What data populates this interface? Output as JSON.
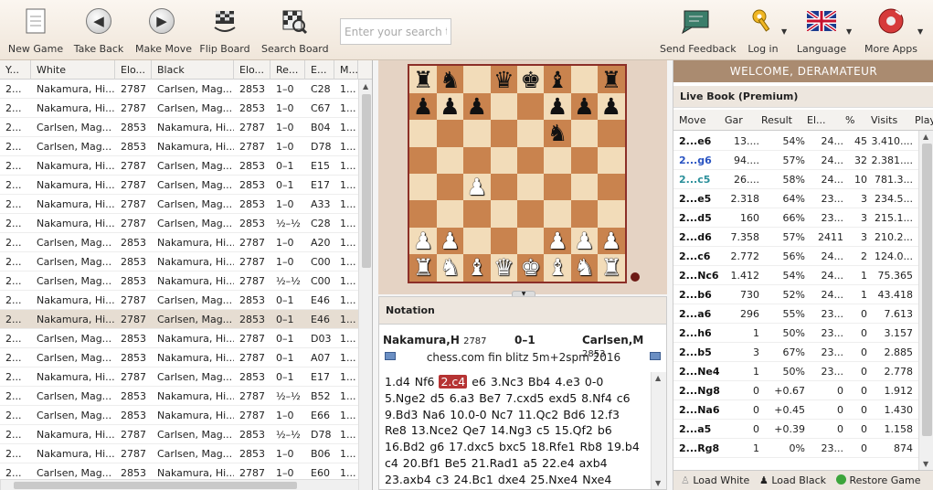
{
  "toolbar": {
    "new_game": "New Game",
    "take_back": "Take Back",
    "make_move": "Make Move",
    "flip_board": "Flip Board",
    "search_board": "Search Board",
    "search_placeholder": "Enter your search tex",
    "feedback": "Send Feedback",
    "login": "Log in",
    "language": "Language",
    "more_apps": "More Apps"
  },
  "games": {
    "headers": [
      "Y...",
      "White",
      "Elo...",
      "Black",
      "Elo...",
      "Re...",
      "E...",
      "M..."
    ],
    "rows": [
      [
        "2...",
        "Nakamura, Hi...",
        "2787",
        "Carlsen, Mag...",
        "2853",
        "1–0",
        "C28",
        "1..."
      ],
      [
        "2...",
        "Nakamura, Hi...",
        "2787",
        "Carlsen, Mag...",
        "2853",
        "1–0",
        "C67",
        "1..."
      ],
      [
        "2...",
        "Carlsen, Mag...",
        "2853",
        "Nakamura, Hi...",
        "2787",
        "1–0",
        "B04",
        "1..."
      ],
      [
        "2...",
        "Carlsen, Mag...",
        "2853",
        "Nakamura, Hi...",
        "2787",
        "1–0",
        "D78",
        "1..."
      ],
      [
        "2...",
        "Nakamura, Hi...",
        "2787",
        "Carlsen, Mag...",
        "2853",
        "0–1",
        "E15",
        "1..."
      ],
      [
        "2...",
        "Nakamura, Hi...",
        "2787",
        "Carlsen, Mag...",
        "2853",
        "0–1",
        "E17",
        "1..."
      ],
      [
        "2...",
        "Nakamura, Hi...",
        "2787",
        "Carlsen, Mag...",
        "2853",
        "1–0",
        "A33",
        "1..."
      ],
      [
        "2...",
        "Nakamura, Hi...",
        "2787",
        "Carlsen, Mag...",
        "2853",
        "½–½",
        "C28",
        "1..."
      ],
      [
        "2...",
        "Carlsen, Mag...",
        "2853",
        "Nakamura, Hi...",
        "2787",
        "1–0",
        "A20",
        "1..."
      ],
      [
        "2...",
        "Carlsen, Mag...",
        "2853",
        "Nakamura, Hi...",
        "2787",
        "1–0",
        "C00",
        "1..."
      ],
      [
        "2...",
        "Carlsen, Mag...",
        "2853",
        "Nakamura, Hi...",
        "2787",
        "½–½",
        "C00",
        "1..."
      ],
      [
        "2...",
        "Nakamura, Hi...",
        "2787",
        "Carlsen, Mag...",
        "2853",
        "0–1",
        "E46",
        "1..."
      ],
      [
        "2...",
        "Nakamura, Hi...",
        "2787",
        "Carlsen, Mag...",
        "2853",
        "0–1",
        "E46",
        "1..."
      ],
      [
        "2...",
        "Carlsen, Mag...",
        "2853",
        "Nakamura, Hi...",
        "2787",
        "0–1",
        "D03",
        "1..."
      ],
      [
        "2...",
        "Carlsen, Mag...",
        "2853",
        "Nakamura, Hi...",
        "2787",
        "0–1",
        "A07",
        "1..."
      ],
      [
        "2...",
        "Nakamura, Hi...",
        "2787",
        "Carlsen, Mag...",
        "2853",
        "0–1",
        "E17",
        "1..."
      ],
      [
        "2...",
        "Carlsen, Mag...",
        "2853",
        "Nakamura, Hi...",
        "2787",
        "½–½",
        "B52",
        "1..."
      ],
      [
        "2...",
        "Carlsen, Mag...",
        "2853",
        "Nakamura, Hi...",
        "2787",
        "1–0",
        "E66",
        "1..."
      ],
      [
        "2...",
        "Nakamura, Hi...",
        "2787",
        "Carlsen, Mag...",
        "2853",
        "½–½",
        "D78",
        "1..."
      ],
      [
        "2...",
        "Nakamura, Hi...",
        "2787",
        "Carlsen, Mag...",
        "2853",
        "1–0",
        "B06",
        "1..."
      ],
      [
        "2...",
        "Carlsen, Mag...",
        "2853",
        "Nakamura, Hi...",
        "2787",
        "1–0",
        "E60",
        "1..."
      ]
    ],
    "selected_row": 12
  },
  "board": {
    "rows": [
      "rn.qkb.r",
      "ppp..ppp",
      ".....n..",
      "........",
      "..P.....",
      "........",
      "PP...PPP",
      "RNBQKBNR"
    ]
  },
  "notation": {
    "title": "Notation",
    "white": "Nakamura,H",
    "white_elo": "2787",
    "result": "0–1",
    "black": "Carlsen,M",
    "black_elo": "2853",
    "event": "chess.com fin blitz 5m+2spm 2016",
    "moves_before": "1.d4  Nf6 ",
    "current_move": "2.c4",
    "moves_after": " e6  3.Nc3  Bb4  4.e3  0-0  5.Nge2  d5  6.a3  Be7  7.cxd5  exd5  8.Nf4  c6  9.Bd3  Na6  10.0-0  Nc7  11.Qc2  Bd6  12.f3  Re8  13.Nce2  Qe7  14.Ng3  c5  15.Qf2  b6  16.Bd2  g6  17.dxc5  bxc5  18.Rfe1  Rb8  19.b4  c4  20.Bf1  Be5  21.Rad1  a5  22.e4  axb4  23.axb4  c3  24.Bc1  dxe4  25.Nxe4  Nxe4"
  },
  "right": {
    "welcome": "WELCOME, DERAMATEUR",
    "livebook": "Live Book (Premium)",
    "headers": [
      "Move",
      "Gar",
      "Result",
      "El...",
      "%",
      "Visits",
      "Play"
    ],
    "rows": [
      [
        "2...e6",
        "13....",
        "54%",
        "24...",
        "45",
        "3.410....",
        "#111"
      ],
      [
        "2...g6",
        "94....",
        "57%",
        "24...",
        "32",
        "2.381....",
        "#2a54c2"
      ],
      [
        "2...c5",
        "26....",
        "58%",
        "24...",
        "10",
        "781.3...",
        "#2a8f9a"
      ],
      [
        "2...e5",
        "2.318",
        "64%",
        "23...",
        "3",
        "234.5...",
        "#111"
      ],
      [
        "2...d5",
        "160",
        "66%",
        "23...",
        "3",
        "215.1...",
        "#111"
      ],
      [
        "2...d6",
        "7.358",
        "57%",
        "2411",
        "3",
        "210.2...",
        "#111"
      ],
      [
        "2...c6",
        "2.772",
        "56%",
        "24...",
        "2",
        "124.0...",
        "#111"
      ],
      [
        "2...Nc6",
        "1.412",
        "54%",
        "24...",
        "1",
        "75.365",
        "#111"
      ],
      [
        "2...b6",
        "730",
        "52%",
        "24...",
        "1",
        "43.418",
        "#111"
      ],
      [
        "2...a6",
        "296",
        "55%",
        "23...",
        "0",
        "7.613",
        "#111"
      ],
      [
        "2...h6",
        "1",
        "50%",
        "23...",
        "0",
        "3.157",
        "#111"
      ],
      [
        "2...b5",
        "3",
        "67%",
        "23...",
        "0",
        "2.885",
        "#111"
      ],
      [
        "2...Ne4",
        "1",
        "50%",
        "23...",
        "0",
        "2.778",
        "#111"
      ],
      [
        "2...Ng8",
        "0",
        "+0.67",
        "0",
        "0",
        "1.912",
        "#111"
      ],
      [
        "2...Na6",
        "0",
        "+0.45",
        "0",
        "0",
        "1.430",
        "#111"
      ],
      [
        "2...a5",
        "0",
        "+0.39",
        "0",
        "0",
        "1.158",
        "#111"
      ],
      [
        "2...Rg8",
        "1",
        "0%",
        "23...",
        "0",
        "874",
        "#111"
      ]
    ],
    "load_white": "Load White",
    "load_black": "Load Black",
    "restore": "Restore Game"
  }
}
